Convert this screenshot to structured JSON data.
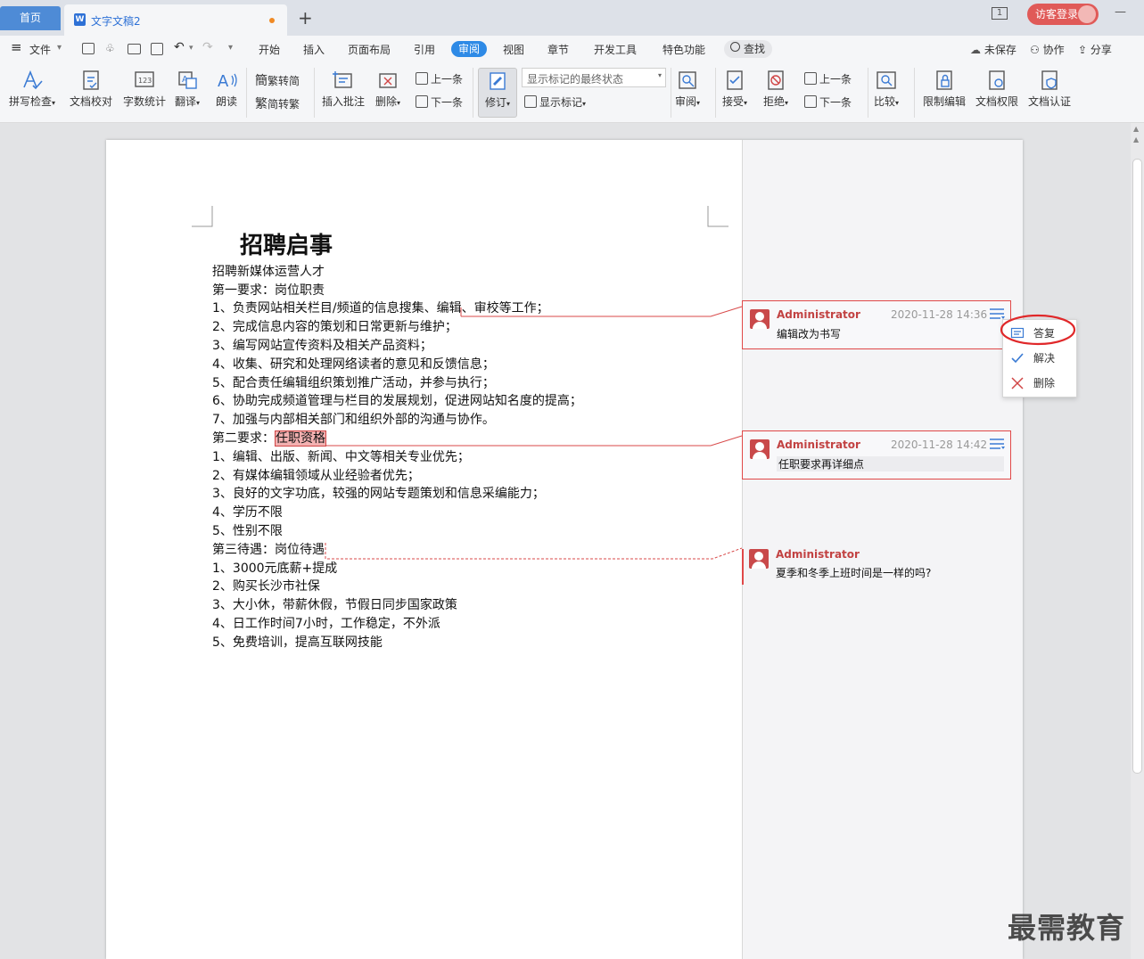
{
  "tabs": {
    "home": "首页",
    "doc": "文字文稿2",
    "new_tab": "+"
  },
  "titlebar": {
    "login": "访客登录",
    "page_indicator": "1"
  },
  "menubar": {
    "file": "文件",
    "items": [
      "开始",
      "插入",
      "页面布局",
      "引用",
      "审阅",
      "视图",
      "章节",
      "开发工具",
      "特色功能"
    ],
    "active": "审阅",
    "search": "查找",
    "unsaved": "未保存",
    "collab": "协作",
    "share": "分享"
  },
  "toolbar": {
    "spell": "拼写检查",
    "proof": "文档校对",
    "wordcount": "字数统计",
    "translate": "翻译",
    "read": "朗读",
    "t2s": "繁转简",
    "s2t": "简转繁",
    "insert_comment": "插入批注",
    "delete": "删除",
    "prev": "上一条",
    "next": "下一条",
    "revise": "修订",
    "markup_state": "显示标记的最终状态",
    "show_markup": "显示标记",
    "review": "审阅",
    "accept": "接受",
    "reject": "拒绝",
    "prev2": "上一条",
    "next2": "下一条",
    "compare": "比较",
    "restrict": "限制编辑",
    "permission": "文档权限",
    "certify": "文档认证"
  },
  "document": {
    "title": "招聘启事",
    "lines": [
      "招聘新媒体运营人才",
      "第一要求：岗位职责",
      "1、负责网站相关栏目/频道的信息搜集、编辑、审校等工作；",
      "2、完成信息内容的策划和日常更新与维护；",
      "3、编写网站宣传资料及相关产品资料；",
      "4、收集、研究和处理网络读者的意见和反馈信息；",
      "5、配合责任编辑组织策划推广活动，并参与执行；",
      "6、协助完成频道管理与栏目的发展规划，促进网站知名度的提高；",
      "7、加强与内部相关部门和组织外部的沟通与协作。",
      "第二要求：",
      "1、编辑、出版、新闻、中文等相关专业优先；",
      "2、有媒体编辑领域从业经验者优先；",
      "3、良好的文字功底，较强的网站专题策划和信息采编能力；",
      "4、学历不限",
      "5、性别不限",
      "第三待遇：岗位待遇",
      "1、3000元底薪+提成",
      "2、购买长沙市社保",
      "3、大小休，带薪休假，节假日同步国家政策",
      "4、日工作时间7小时，工作稳定，不外派",
      "5、免费培训，提高互联网技能"
    ],
    "highlight": "任职资格"
  },
  "comments": [
    {
      "author": "Administrator",
      "date": "2020-11-28 14:36",
      "text": "编辑改为书写"
    },
    {
      "author": "Administrator",
      "date": "2020-11-28 14:42",
      "text": "任职要求再详细点"
    },
    {
      "author": "Administrator",
      "date": "",
      "text": "夏季和冬季上班时间是一样的吗?"
    }
  ],
  "popup": {
    "reply": "答复",
    "resolve": "解决",
    "delete": "删除"
  },
  "colors": {
    "accent": "#2e8ae6",
    "comment_red": "#e04848",
    "highlight": "#f3b1b1"
  },
  "watermark": "最需教育"
}
